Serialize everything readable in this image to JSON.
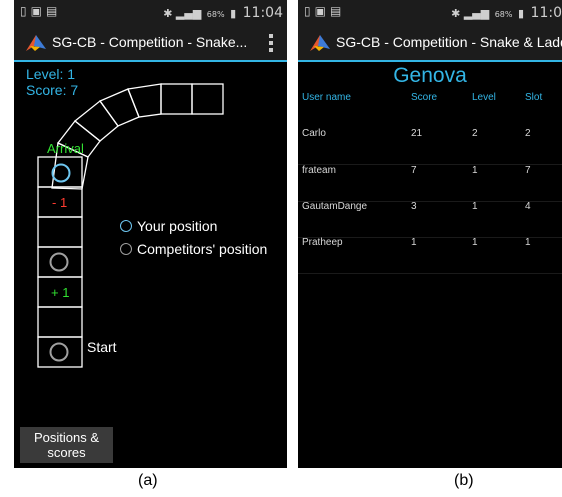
{
  "panel_a": {
    "caption": "(a)",
    "status": {
      "time": "11:04",
      "battery": "68%"
    },
    "title": "SG-CB - Competition - Snake...",
    "level": "Level: 1",
    "score": "Score: 7",
    "tiles": {
      "arrival": "Arrival",
      "minus": "- 1",
      "plus": "+ 1",
      "start": "Start"
    },
    "legend": {
      "yours": "Your position",
      "competitors": "Competitors' position"
    },
    "button": {
      "line1": "Positions &",
      "line2": "scores"
    },
    "colors": {
      "your_marker": "#6ec6f0",
      "competitor_marker": "#a0a0a0",
      "penalty": "#ff3b30",
      "bonus": "#32e132"
    }
  },
  "panel_b": {
    "caption": "(b)",
    "status": {
      "time": "11:0",
      "battery": "68%"
    },
    "title": "SG-CB - Competition - Snake & Ladd..",
    "board_name": "Genova",
    "columns": {
      "user": "User name",
      "score": "Score",
      "level": "Level",
      "slot": "Slot"
    },
    "rows": [
      {
        "user": "Carlo",
        "score": "21",
        "level": "2",
        "slot": "2"
      },
      {
        "user": "frateam",
        "score": "7",
        "level": "1",
        "slot": "7"
      },
      {
        "user": "GautamDange",
        "score": "3",
        "level": "1",
        "slot": "4"
      },
      {
        "user": "Pratheep",
        "score": "1",
        "level": "1",
        "slot": "1"
      }
    ]
  },
  "accent_color": "#33b5e5"
}
